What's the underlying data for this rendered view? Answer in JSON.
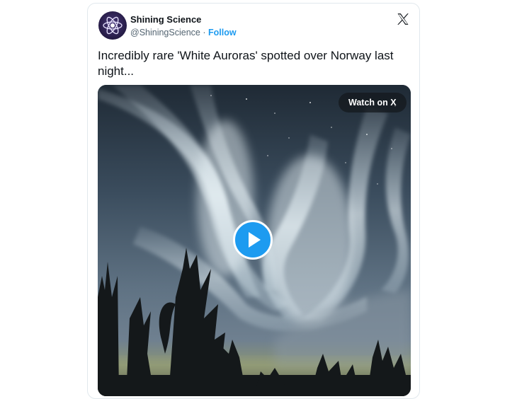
{
  "tweet": {
    "display_name": "Shining Science",
    "handle": "@ShiningScience",
    "separator": "·",
    "follow_label": "Follow",
    "text": "Incredibly rare 'White Auroras' spotted over Norway last night...",
    "media": {
      "watch_label": "Watch on X",
      "play_icon": "play-icon"
    }
  },
  "icons": {
    "brand": "x-logo-icon",
    "avatar": "atom-icon"
  },
  "colors": {
    "accent": "#1d9bf0",
    "text": "#0f1419",
    "secondary_text": "#536471",
    "border": "#e1e8ed"
  }
}
